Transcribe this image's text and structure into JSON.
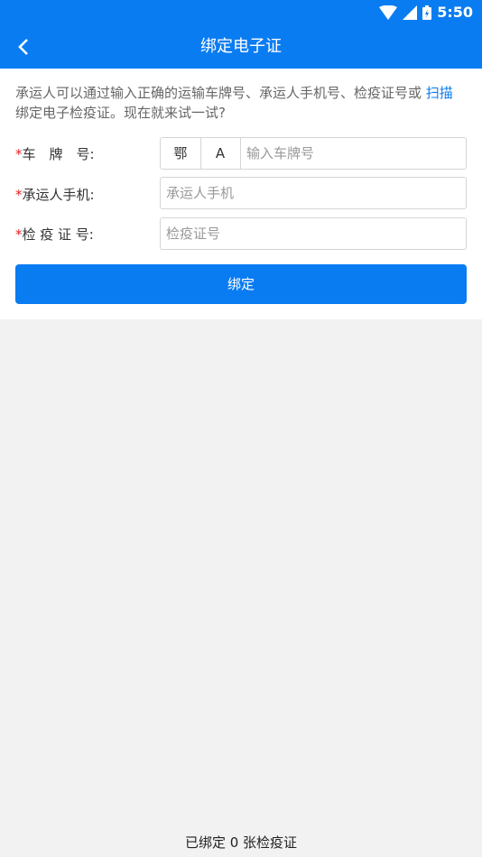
{
  "status_bar": {
    "time": "5:50"
  },
  "header": {
    "title": "绑定电子证"
  },
  "intro": {
    "text_before": "承运人可以通过输入正确的运输车牌号、承运人手机号、检疫证号或 ",
    "link": "扫描",
    "text_after": " 绑定电子检疫证。现在就来试一试?"
  },
  "form": {
    "required_mark": "*",
    "plate": {
      "label": "车　牌　号:",
      "province": "鄂",
      "letter": "A",
      "placeholder": "输入车牌号"
    },
    "phone": {
      "label": "承运人手机:",
      "placeholder": "承运人手机"
    },
    "cert": {
      "label": "检 疫 证 号:",
      "placeholder": "检疫证号"
    },
    "submit_label": "绑定"
  },
  "footer": {
    "text": "已绑定 0 张检疫证"
  }
}
